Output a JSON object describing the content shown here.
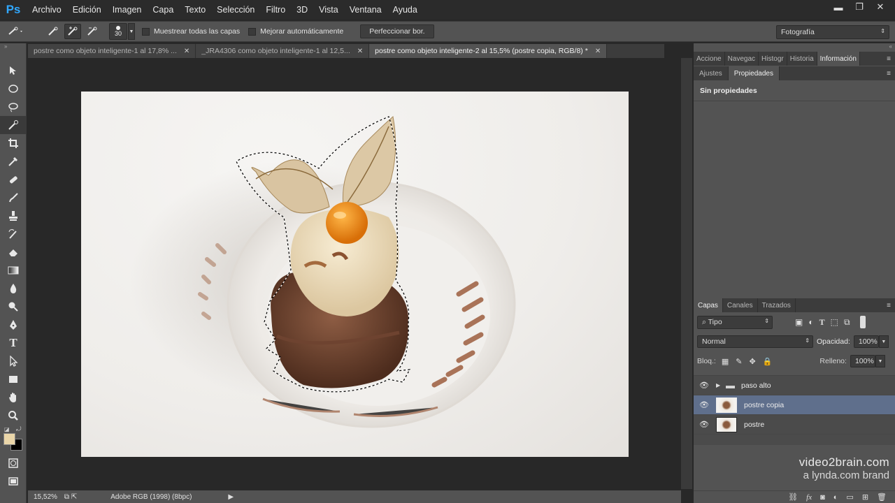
{
  "app": {
    "logo": "Ps"
  },
  "menu": [
    "Archivo",
    "Edición",
    "Imagen",
    "Capa",
    "Texto",
    "Selección",
    "Filtro",
    "3D",
    "Vista",
    "Ventana",
    "Ayuda"
  ],
  "window_controls": {
    "minimize": "▬",
    "restore": "❐",
    "close": "✕"
  },
  "options": {
    "brush_size": "30",
    "sample_all_layers": "Muestrear todas las capas",
    "auto_enhance": "Mejorar automáticamente",
    "refine_edge": "Perfeccionar bor.",
    "workspace": "Fotografía"
  },
  "tabs": [
    {
      "label": "postre como objeto inteligente-1 al 17,8% ...",
      "close": "✕"
    },
    {
      "label": "_JRA4306 como objeto inteligente-1 al 12,5...",
      "close": "✕"
    },
    {
      "label": "postre como objeto inteligente-2 al 15,5% (postre copia, RGB/8) *",
      "close": "✕"
    }
  ],
  "status": {
    "zoom": "15,52%",
    "profile": "Adobe RGB (1998) (8bpc)"
  },
  "panels": {
    "top_tabs": [
      "Accione",
      "Navegac",
      "Histogr",
      "Historia",
      "Información"
    ],
    "props_tabs": [
      "Ajustes",
      "Propiedades"
    ],
    "props_text": "Sin propiedades",
    "layers_tabs": [
      "Capas",
      "Canales",
      "Trazados"
    ],
    "filter_kind": "Tipo",
    "blend_mode": "Normal",
    "opacity_label": "Opacidad:",
    "opacity": "100%",
    "lock_label": "Bloq.:",
    "fill_label": "Relleno:",
    "fill": "100%",
    "layers": [
      {
        "name": "paso alto"
      },
      {
        "name": "postre copia"
      },
      {
        "name": "postre"
      }
    ]
  },
  "watermark": {
    "line1": "video2brain.com",
    "line2": "a lynda.com brand"
  }
}
